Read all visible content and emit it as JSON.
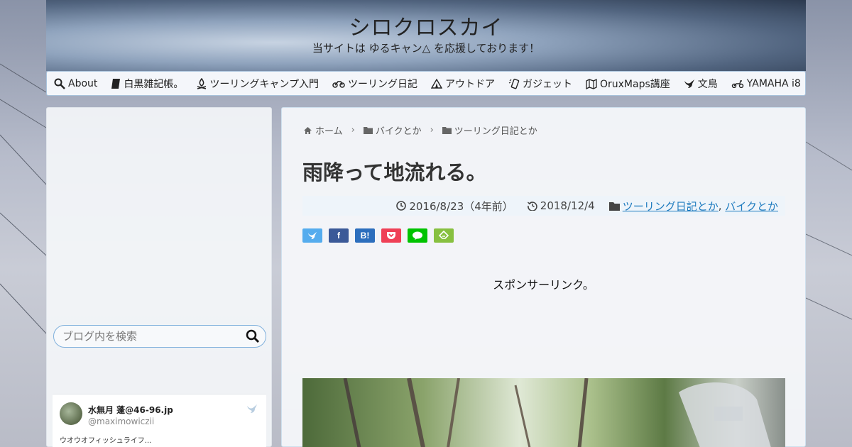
{
  "header": {
    "title": "シロクロスカイ",
    "tagline": "当サイトは ゆるキャン△ を応援しております！"
  },
  "nav": [
    {
      "label": "About",
      "icon": "search-icon"
    },
    {
      "label": "白黒雑記帳。",
      "icon": "book-icon"
    },
    {
      "label": "ツーリングキャンプ入門",
      "icon": "campfire-icon"
    },
    {
      "label": "ツーリング日記",
      "icon": "motorcycle-icon"
    },
    {
      "label": "アウトドア",
      "icon": "tent-icon"
    },
    {
      "label": "ガジェット",
      "icon": "phone-icon"
    },
    {
      "label": "OruxMaps講座",
      "icon": "map-icon"
    },
    {
      "label": "文鳥",
      "icon": "bird-icon"
    },
    {
      "label": "YAMAHA i8",
      "icon": "scooter-icon"
    }
  ],
  "sidebar": {
    "search_placeholder": "ブログ内を検索",
    "twitter": {
      "name": "水無月 蓬@46-96.jp",
      "handle": "@maximowiczii",
      "text": "ウオウオフィッシュライフ..."
    }
  },
  "breadcrumb": [
    {
      "label": "ホーム",
      "icon": "home-icon"
    },
    {
      "label": "バイクとか",
      "icon": "folder-icon"
    },
    {
      "label": "ツーリング日記とか",
      "icon": "folder-icon"
    }
  ],
  "post": {
    "title": "雨降って地流れる。",
    "published": "2016/8/23（4年前）",
    "updated": "2018/12/4",
    "categories": [
      "ツーリング日記とか",
      "バイクとか"
    ],
    "category_separator": ","
  },
  "share": [
    {
      "name": "twitter",
      "label": "",
      "color": "#55acee"
    },
    {
      "name": "facebook",
      "label": "f",
      "color": "#3b5998"
    },
    {
      "name": "hatena",
      "label": "B!",
      "color": "#2c6ebd"
    },
    {
      "name": "pocket",
      "label": "",
      "color": "#ef4056"
    },
    {
      "name": "line",
      "label": "",
      "color": "#00c300"
    },
    {
      "name": "feedly",
      "label": "",
      "color": "#87c040"
    }
  ],
  "sponsor_label": "スポンサーリンク。"
}
